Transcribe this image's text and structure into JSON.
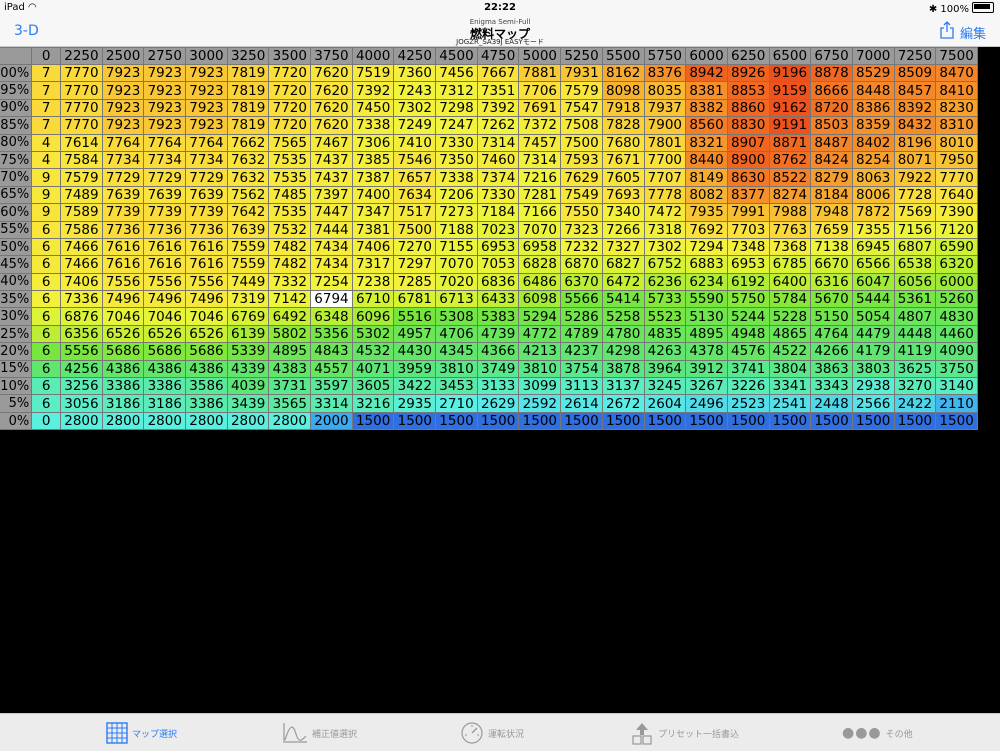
{
  "status_bar": {
    "device": "iPad",
    "time": "22:22",
    "battery": "100%"
  },
  "nav": {
    "back_label": "3-D",
    "subtitle": "Enigma Semi-Full",
    "title": "燃料マップ",
    "caption": "JOGZR_SA39J EASYモード",
    "edit_label": "編集"
  },
  "table": {
    "columns": [
      "0",
      "2250",
      "2500",
      "2750",
      "3000",
      "3250",
      "3500",
      "3750",
      "4000",
      "4250",
      "4500",
      "4750",
      "5000",
      "5250",
      "5500",
      "5750",
      "6000",
      "6250",
      "6500",
      "6750",
      "7000",
      "7250",
      "7500"
    ],
    "rows": [
      {
        "label": "100%",
        "values": [
          7,
          7770,
          7923,
          7923,
          7923,
          7819,
          7720,
          7620,
          7519,
          7360,
          7456,
          7667,
          7881,
          7931,
          8162,
          8376,
          8942,
          8926,
          9196,
          8878,
          8529,
          8509,
          8470
        ]
      },
      {
        "label": "95%",
        "values": [
          7,
          7770,
          7923,
          7923,
          7923,
          7819,
          7720,
          7620,
          7392,
          7243,
          7312,
          7351,
          7706,
          7579,
          8098,
          8035,
          8381,
          8853,
          9159,
          8666,
          8448,
          8457,
          8410
        ]
      },
      {
        "label": "90%",
        "values": [
          7,
          7770,
          7923,
          7923,
          7923,
          7819,
          7720,
          7620,
          7450,
          7302,
          7298,
          7392,
          7691,
          7547,
          7918,
          7937,
          8382,
          8860,
          9162,
          8720,
          8386,
          8392,
          8230
        ]
      },
      {
        "label": "85%",
        "values": [
          7,
          7770,
          7923,
          7923,
          7923,
          7819,
          7720,
          7620,
          7338,
          7249,
          7247,
          7262,
          7372,
          7508,
          7828,
          7900,
          8560,
          8830,
          9191,
          8503,
          8359,
          8432,
          8310
        ]
      },
      {
        "label": "80%",
        "values": [
          4,
          7614,
          7764,
          7764,
          7764,
          7662,
          7565,
          7467,
          7306,
          7410,
          7330,
          7314,
          7457,
          7500,
          7680,
          7801,
          8321,
          8907,
          8871,
          8487,
          8402,
          8196,
          8010
        ]
      },
      {
        "label": "75%",
        "values": [
          4,
          7584,
          7734,
          7734,
          7734,
          7632,
          7535,
          7437,
          7385,
          7546,
          7350,
          7460,
          7314,
          7593,
          7671,
          7700,
          8440,
          8900,
          8762,
          8424,
          8254,
          8071,
          7950
        ]
      },
      {
        "label": "70%",
        "values": [
          9,
          7579,
          7729,
          7729,
          7729,
          7632,
          7535,
          7437,
          7387,
          7657,
          7338,
          7374,
          7216,
          7629,
          7605,
          7707,
          8149,
          8630,
          8522,
          8279,
          8063,
          7922,
          7770
        ]
      },
      {
        "label": "65%",
        "values": [
          9,
          7489,
          7639,
          7639,
          7639,
          7562,
          7485,
          7397,
          7400,
          7634,
          7206,
          7330,
          7281,
          7549,
          7693,
          7778,
          8082,
          8377,
          8274,
          8184,
          8006,
          7728,
          7640
        ]
      },
      {
        "label": "60%",
        "values": [
          9,
          7589,
          7739,
          7739,
          7739,
          7642,
          7535,
          7447,
          7347,
          7517,
          7273,
          7184,
          7166,
          7550,
          7340,
          7472,
          7935,
          7991,
          7988,
          7948,
          7872,
          7569,
          7390
        ]
      },
      {
        "label": "55%",
        "values": [
          6,
          7586,
          7736,
          7736,
          7736,
          7639,
          7532,
          7444,
          7381,
          7500,
          7188,
          7023,
          7070,
          7323,
          7266,
          7318,
          7692,
          7703,
          7763,
          7659,
          7355,
          7156,
          7120
        ]
      },
      {
        "label": "50%",
        "values": [
          6,
          7466,
          7616,
          7616,
          7616,
          7559,
          7482,
          7434,
          7406,
          7270,
          7155,
          6953,
          6958,
          7232,
          7327,
          7302,
          7294,
          7348,
          7368,
          7138,
          6945,
          6807,
          6590
        ]
      },
      {
        "label": "45%",
        "values": [
          6,
          7466,
          7616,
          7616,
          7616,
          7559,
          7482,
          7434,
          7317,
          7297,
          7070,
          7053,
          6828,
          6870,
          6827,
          6752,
          6883,
          6953,
          6785,
          6670,
          6566,
          6538,
          6320
        ]
      },
      {
        "label": "40%",
        "values": [
          6,
          7406,
          7556,
          7556,
          7556,
          7449,
          7332,
          7254,
          7238,
          7285,
          7020,
          6836,
          6486,
          6370,
          6472,
          6236,
          6234,
          6192,
          6400,
          6316,
          6047,
          6056,
          6000
        ]
      },
      {
        "label": "35%",
        "values": [
          6,
          7336,
          7496,
          7496,
          7496,
          7319,
          7142,
          6794,
          6710,
          6781,
          6713,
          6433,
          6098,
          5566,
          5414,
          5733,
          5590,
          5750,
          5784,
          5670,
          5444,
          5361,
          5260
        ]
      },
      {
        "label": "30%",
        "values": [
          6,
          6876,
          7046,
          7046,
          7046,
          6769,
          6492,
          6348,
          6096,
          5516,
          5308,
          5383,
          5294,
          5286,
          5258,
          5523,
          5130,
          5244,
          5228,
          5150,
          5054,
          4807,
          4830
        ]
      },
      {
        "label": "25%",
        "values": [
          6,
          6356,
          6526,
          6526,
          6526,
          6139,
          5802,
          5356,
          5302,
          4957,
          4706,
          4739,
          4772,
          4789,
          4780,
          4835,
          4895,
          4948,
          4865,
          4764,
          4479,
          4448,
          4460
        ]
      },
      {
        "label": "20%",
        "values": [
          6,
          5556,
          5686,
          5686,
          5686,
          5339,
          4895,
          4843,
          4532,
          4430,
          4345,
          4366,
          4213,
          4237,
          4298,
          4263,
          4378,
          4576,
          4522,
          4266,
          4179,
          4119,
          4090
        ]
      },
      {
        "label": "15%",
        "values": [
          6,
          4256,
          4386,
          4386,
          4386,
          4339,
          4383,
          4557,
          4071,
          3959,
          3810,
          3749,
          3810,
          3754,
          3878,
          3964,
          3912,
          3741,
          3804,
          3863,
          3803,
          3625,
          3750
        ]
      },
      {
        "label": "10%",
        "values": [
          6,
          3256,
          3386,
          3386,
          3586,
          4039,
          3731,
          3597,
          3605,
          3422,
          3453,
          3133,
          3099,
          3113,
          3137,
          3245,
          3267,
          3226,
          3341,
          3343,
          2938,
          3270,
          3140
        ]
      },
      {
        "label": "5%",
        "values": [
          6,
          3056,
          3186,
          3186,
          3386,
          3439,
          3565,
          3314,
          3216,
          2935,
          2710,
          2629,
          2592,
          2614,
          2672,
          2604,
          2496,
          2523,
          2541,
          2448,
          2566,
          2422,
          2110
        ]
      },
      {
        "label": "0%",
        "values": [
          0,
          2800,
          2800,
          2800,
          2800,
          2800,
          2800,
          2000,
          1500,
          1500,
          1500,
          1500,
          1500,
          1500,
          1500,
          1500,
          1500,
          1500,
          1500,
          1500,
          1500,
          1500,
          1500
        ]
      }
    ],
    "selected": {
      "row": "35%",
      "column": "3750"
    },
    "color_scale": {
      "min_color": "#2f6fe0",
      "mid_color": "#c8f03c",
      "max_color": "#f04a1c"
    }
  },
  "tabs": [
    {
      "label": "マップ選択",
      "icon": "grid-icon",
      "active": true
    },
    {
      "label": "補正値選択",
      "icon": "curve-chart-icon",
      "active": false
    },
    {
      "label": "運転状況",
      "icon": "speedometer-icon",
      "active": false
    },
    {
      "label": "プリセット一括書込",
      "icon": "upload-building-icon",
      "active": false
    },
    {
      "label": "その他",
      "icon": "more-dots-icon",
      "active": false
    }
  ],
  "colors": {
    "accent": "#2b7cf4",
    "bar_bg": "#f7f7f7",
    "header_bg": "#9a9a9a"
  }
}
